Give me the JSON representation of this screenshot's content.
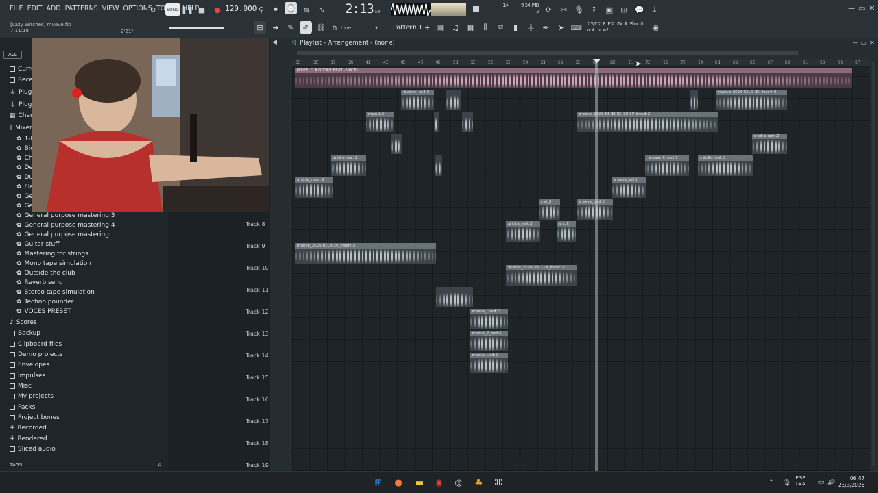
{
  "menu": [
    "FILE",
    "EDIT",
    "ADD",
    "PATTERNS",
    "VIEW",
    "OPTIONS",
    "TOOLS",
    "HELP"
  ],
  "transport": {
    "song_label": "SONG",
    "tempo": "120.000",
    "time": "2:13",
    "time_sub": "09"
  },
  "status": {
    "cpu": "14",
    "memory": "904 MB",
    "mem_sub": "3"
  },
  "news": {
    "line1": "26/02 FLEX: Drift Phonk",
    "line2": "out now!"
  },
  "project": {
    "name_prefix": "[Lazy Witches]",
    "name": "mueve.flp",
    "time": "7:11:18",
    "hint": "2'21\""
  },
  "toolbar": {
    "snap": "Line",
    "pattern": "Pattern 1"
  },
  "browser": {
    "tab_all": "ALL",
    "top_folders": [
      "Curre",
      "Recer",
      "Plugi",
      "Plugi",
      "Chann",
      "Mixer"
    ],
    "mixer_items_short": [
      "1-b",
      "Big",
      "Cho",
      "Def",
      "Dua",
      "Fla",
      "Ger",
      "Ger"
    ],
    "mixer_items": [
      "General purpose mastering 3",
      "General purpose mastering 4",
      "General purpose mastering",
      "Guitar stuff",
      "Mastering for strings",
      "Mono tape simulation",
      "Outside the club",
      "Reverb send",
      "Stereo tape simulation",
      "Techno pounder",
      "VOCES PRESET"
    ],
    "folders": [
      "Scores",
      "Backup",
      "Clipboard files",
      "Demo projects",
      "Envelopes",
      "Impulses",
      "Misc",
      "My projects",
      "Packs",
      "Project bones",
      "Recorded",
      "Rendered",
      "Sliced audio"
    ],
    "tags": "TAGS"
  },
  "playlist": {
    "title": "Playlist - Arrangement - (none)",
    "ruler": [
      "33",
      "35",
      "37",
      "39",
      "41",
      "43",
      "45",
      "47",
      "49",
      "51",
      "53",
      "55",
      "57",
      "59",
      "61",
      "63",
      "65",
      "67",
      "69",
      "71",
      "73",
      "75",
      "77",
      "79",
      "81",
      "83",
      "85",
      "87",
      "89",
      "91",
      "93",
      "95",
      "97"
    ],
    "track_labels": [
      "Track 8",
      "Track 9",
      "Track 10",
      "Track 11",
      "Track 12",
      "Track 13",
      "Track 14",
      "Track 15",
      "Track 16",
      "Track 17",
      "Track 18",
      "Track 19"
    ],
    "clips": [
      {
        "label": "[FREE] C R O TYPE BEAT - VACIO"
      },
      {
        "label": "mueve_..ert 2"
      },
      {
        "label": "mueve_2026-03..5-19_Insert 2"
      },
      {
        "label": "mue..t 2"
      },
      {
        "label": "mueve_2026-03-18 02-53-57_Insert 2"
      },
      {
        "label": "untitle_sert 2"
      },
      {
        "label": "untitle_sert 2"
      },
      {
        "label": "mueve_2_sert 2"
      },
      {
        "label": "untitle_sert 2"
      },
      {
        "label": "untitle_nsert 2"
      },
      {
        "label": "mueve_ert 2"
      },
      {
        "label": "unt_2"
      },
      {
        "label": "mueve_..ert 2"
      },
      {
        "label": "untitle_sert 2"
      },
      {
        "label": "un..2"
      },
      {
        "label": "mueve_2026-03..9-20_Insert 2"
      },
      {
        "label": "mueve_2026-03-..-20_Insert 2"
      },
      {
        "label": "mueve_..sert 2"
      },
      {
        "label": "mueve_2_sert 2"
      },
      {
        "label": "mueve_..ert 2"
      }
    ]
  },
  "taskbar": {
    "lang1": "ESP",
    "lang2": "LAA",
    "time": "06:47",
    "date": "23/3/2026"
  }
}
